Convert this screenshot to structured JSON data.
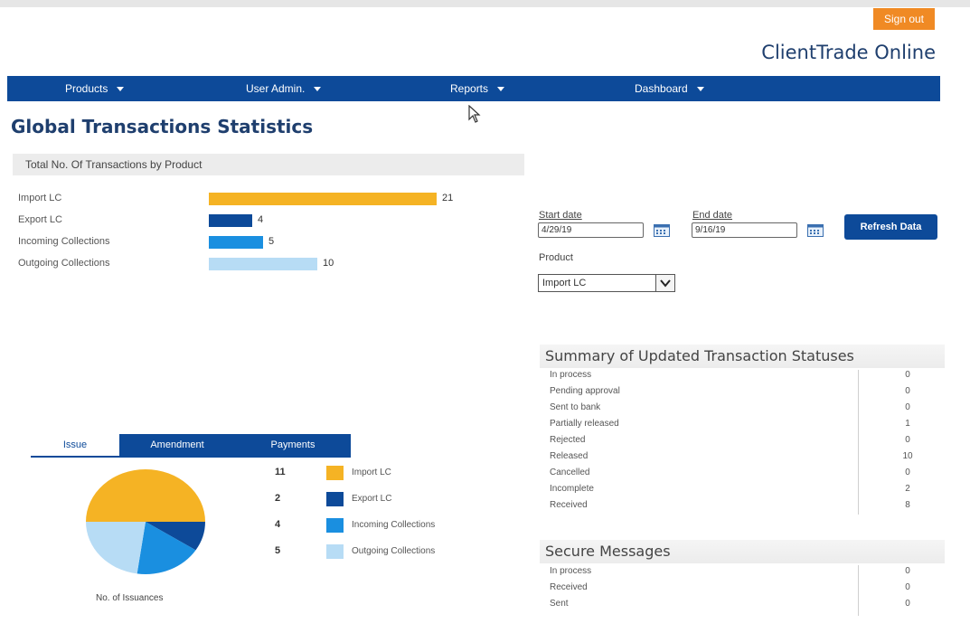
{
  "header": {
    "sign_out_label": "Sign out",
    "brand": "ClientTrade Online"
  },
  "nav": {
    "items": [
      {
        "label": "Products"
      },
      {
        "label": "User Admin."
      },
      {
        "label": "Reports"
      },
      {
        "label": "Dashboard"
      }
    ]
  },
  "page": {
    "title": "Global Transactions Statistics"
  },
  "product_totals": {
    "heading": "Total No. Of Transactions by Product",
    "rows": [
      {
        "label": "Import LC",
        "value": 21,
        "color": "#f5b324"
      },
      {
        "label": "Export LC",
        "value": 4,
        "color": "#0d4a99"
      },
      {
        "label": "Incoming Collections",
        "value": 5,
        "color": "#1a8fe0"
      },
      {
        "label": "Outgoing Collections",
        "value": 10,
        "color": "#b7dcf5"
      }
    ]
  },
  "filters": {
    "start_label": "Start date",
    "start_value": "4/29/19",
    "end_label": "End date",
    "end_value": "9/16/19",
    "refresh_label": "Refresh Data",
    "product_label": "Product",
    "product_value": "Import LC"
  },
  "summary": {
    "title": "Summary of Updated Transaction Statuses",
    "rows": [
      {
        "label": "In process",
        "value": "0"
      },
      {
        "label": "Pending approval",
        "value": "0"
      },
      {
        "label": "Sent to bank",
        "value": "0"
      },
      {
        "label": "Partially released",
        "value": "1"
      },
      {
        "label": "Rejected",
        "value": "0"
      },
      {
        "label": "Released",
        "value": "10"
      },
      {
        "label": "Cancelled",
        "value": "0"
      },
      {
        "label": "Incomplete",
        "value": "2"
      },
      {
        "label": "Received",
        "value": "8"
      }
    ]
  },
  "messages": {
    "title": "Secure Messages",
    "rows": [
      {
        "label": "In process",
        "value": "0"
      },
      {
        "label": "Received",
        "value": "0"
      },
      {
        "label": "Sent",
        "value": "0"
      }
    ]
  },
  "issuance": {
    "tabs": [
      {
        "label": "Issue",
        "active": true
      },
      {
        "label": "Amendment",
        "active": false
      },
      {
        "label": "Payments",
        "active": false
      }
    ],
    "caption": "No. of Issuances",
    "legend": [
      {
        "count": "11",
        "label": "Import LC",
        "color": "#f5b324"
      },
      {
        "count": "2",
        "label": "Export LC",
        "color": "#0d4a99"
      },
      {
        "count": "4",
        "label": "Incoming Collections",
        "color": "#1a8fe0"
      },
      {
        "count": "5",
        "label": "Outgoing Collections",
        "color": "#b7dcf5"
      }
    ]
  }
}
